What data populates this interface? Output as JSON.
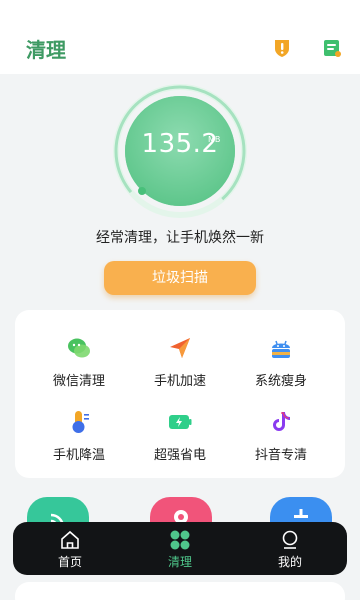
{
  "header": {
    "title": "清理",
    "icons": [
      "alert-shield-icon",
      "notes-icon"
    ],
    "colors": {
      "title": "#3e9a63",
      "alert": "#f2a626",
      "notes": "#3fbf6e"
    }
  },
  "gauge": {
    "value": "135.2",
    "unit": "MB",
    "colors": {
      "ring": "#a6e2c0",
      "fill": "#6fd19a",
      "dot": "#48c07a"
    }
  },
  "slogan": "经常清理，让手机焕然一新",
  "scan_button": {
    "label": "垃圾扫描",
    "color": "#f9b04e"
  },
  "tools": [
    {
      "label": "微信清理",
      "icon": "wechat-icon"
    },
    {
      "label": "手机加速",
      "icon": "paper-plane-icon"
    },
    {
      "label": "系统瘦身",
      "icon": "android-icon"
    },
    {
      "label": "手机降温",
      "icon": "thermometer-icon"
    },
    {
      "label": "超强省电",
      "icon": "battery-icon"
    },
    {
      "label": "抖音专清",
      "icon": "tiktok-icon"
    }
  ],
  "tabbar": {
    "tabs": [
      {
        "label": "首页",
        "icon": "home-icon"
      },
      {
        "label": "清理",
        "icon": "grid-icon"
      },
      {
        "label": "我的",
        "icon": "profile-icon"
      }
    ],
    "active": 1,
    "active_color": "#4fc78b"
  }
}
